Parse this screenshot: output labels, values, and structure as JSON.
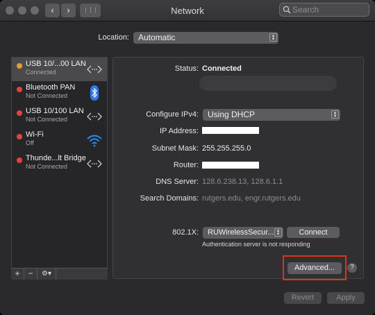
{
  "window": {
    "title": "Network",
    "search_placeholder": "Search",
    "back_glyph": "‹",
    "forward_glyph": "›",
    "grid_glyph": "⋮⋮⋮"
  },
  "location": {
    "label": "Location:",
    "value": "Automatic"
  },
  "services": [
    {
      "name": "USB 10/...00 LAN",
      "status": "Connected",
      "dot_color": "#e0a02e",
      "icon": "ethernet-arrows-icon",
      "selected": true
    },
    {
      "name": "Bluetooth PAN",
      "status": "Not Connected",
      "dot_color": "#e0443c",
      "icon": "bluetooth-icon"
    },
    {
      "name": "USB 10/100 LAN",
      "status": "Not Connected",
      "dot_color": "#e0443c",
      "icon": "ethernet-arrows-icon"
    },
    {
      "name": "Wi-Fi",
      "status": "Off",
      "dot_color": "#e0443c",
      "icon": "wifi-icon"
    },
    {
      "name": "Thunde...lt Bridge",
      "status": "Not Connected",
      "dot_color": "#e0443c",
      "icon": "ethernet-arrows-icon"
    }
  ],
  "sidebar_controls": {
    "add": "+",
    "remove": "−",
    "action": "⚙▾"
  },
  "details": {
    "status_label": "Status:",
    "status_value": "Connected",
    "configure_label": "Configure IPv4:",
    "configure_value": "Using DHCP",
    "ip_label": "IP Address:",
    "subnet_label": "Subnet Mask:",
    "subnet_value": "255.255.255.0",
    "router_label": "Router:",
    "dns_label": "DNS Server:",
    "dns_value": "128.6.238.13, 128.6.1.1",
    "search_domains_label": "Search Domains:",
    "search_domains_value": "rutgers.edu, engr.rutgers.edu",
    "dot1x_label": "802.1X:",
    "dot1x_value": "RUWirelessSecur...",
    "connect_label": "Connect",
    "auth_message": "Authentication server is not responding",
    "advanced_label": "Advanced...",
    "help_label": "?"
  },
  "footer": {
    "revert_label": "Revert",
    "apply_label": "Apply"
  },
  "colors": {
    "connected": "#e0a02e",
    "not_connected": "#e0443c",
    "bluetooth": "#2a7bf0",
    "wifi": "#2a8ef0",
    "highlight": "#e0331c"
  }
}
